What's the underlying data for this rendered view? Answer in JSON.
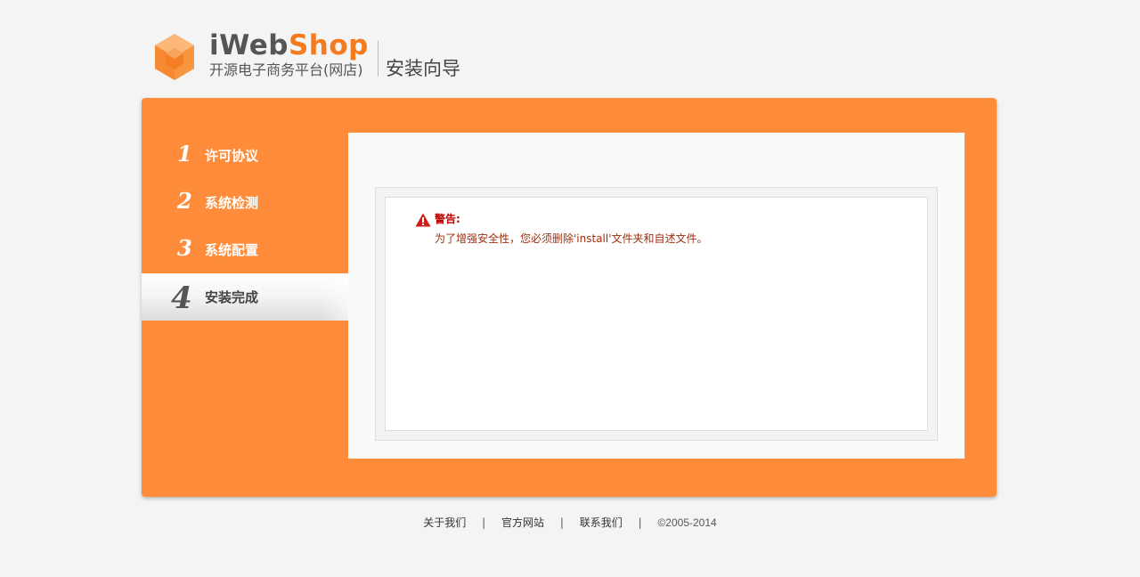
{
  "header": {
    "brand_part1": "iWeb",
    "brand_part2": "Shop",
    "subtitle": "开源电子商务平台(网店)",
    "title": "安装向导"
  },
  "steps": [
    {
      "num": "1",
      "label": "许可协议",
      "active": false
    },
    {
      "num": "2",
      "label": "系统检测",
      "active": false
    },
    {
      "num": "3",
      "label": "系统配置",
      "active": false
    },
    {
      "num": "4",
      "label": "安装完成",
      "active": true
    }
  ],
  "warning": {
    "title": "警告:",
    "message": "为了增强安全性，您必须删除'install'文件夹和自述文件。"
  },
  "footer": {
    "links": [
      "关于我们",
      "官方网站",
      "联系我们"
    ],
    "separator": "|",
    "copyright": "©2005-2014"
  },
  "colors": {
    "accent": "#ff8c3a",
    "brand_orange": "#f47b20",
    "warning_red": "#c00000"
  }
}
